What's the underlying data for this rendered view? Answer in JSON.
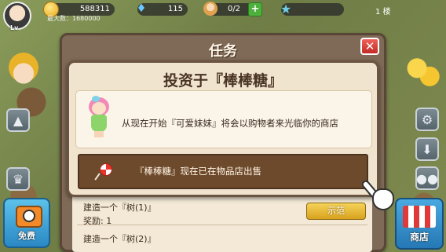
{
  "hud": {
    "gold": "588311",
    "max_label": "最大数：1680000",
    "gems": "115",
    "people": "0/2",
    "floor": "1 楼"
  },
  "left_buttons": {
    "free_label": "免费"
  },
  "right_buttons": {
    "shop_label": "商店"
  },
  "task_panel": {
    "title": "任务",
    "close_symbol": "✕",
    "tasks": [
      {
        "name": "建造一个『树(1)』",
        "reward": "奖励: 1",
        "action": "示范"
      },
      {
        "name": "建造一个『树(2)』"
      }
    ]
  },
  "invest_popup": {
    "title": "投资于『棒棒糖』",
    "intro": "从现在开始『可爱妹妹』将会以购物者来光临你的商店",
    "sale": "『棒棒糖』现在已在物品店出售"
  },
  "icons": {
    "coin": "coin-icon",
    "gem": "gem-icon",
    "star": "star-icon",
    "gear": "gear-icon",
    "camera": "camera-icon",
    "shop": "shop-icon",
    "lollipop": "lollipop-icon",
    "hand": "pointer-hand-icon"
  }
}
